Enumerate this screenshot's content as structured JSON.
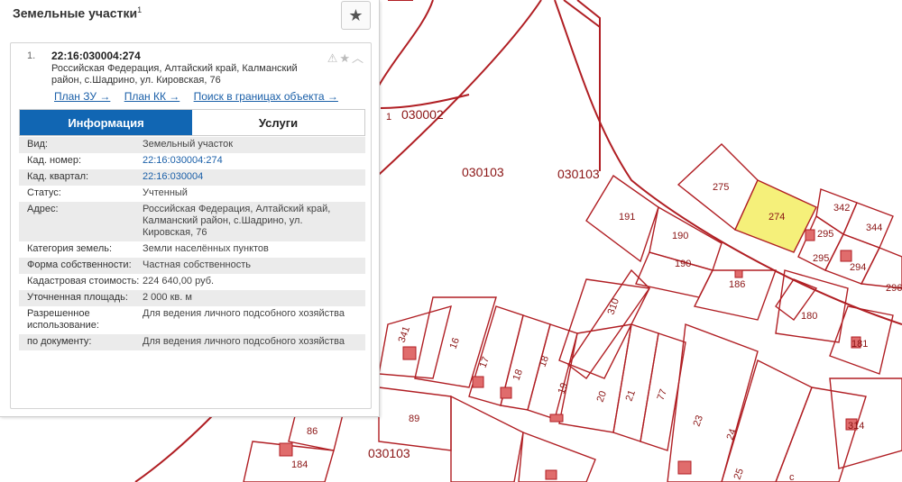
{
  "panel": {
    "title": "Земельные участки",
    "title_sup": "1",
    "star_icon": "★"
  },
  "record": {
    "number": "1.",
    "cad_number": "22:16:030004:274",
    "address": "Российская Федерация, Алтайский край, Калманский район, с.Шадрино, ул. Кировская, 76",
    "icons": "⚠★︿",
    "links": [
      "План ЗУ →",
      "План КК →",
      "Поиск в границах объекта →"
    ]
  },
  "tabs": [
    "Информация",
    "Услуги"
  ],
  "info": [
    {
      "k": "Вид:",
      "v": "Земельный участок"
    },
    {
      "k": "Кад. номер:",
      "v": "22:16:030004:274"
    },
    {
      "k": "Кад. квартал:",
      "v": "22:16:030004"
    },
    {
      "k": "Статус:",
      "v": "Учтенный"
    },
    {
      "k": "Адрес:",
      "v": "Российская Федерация, Алтайский край, Калманский район, с.Шадрино, ул. Кировская, 76"
    },
    {
      "k": "Категория земель:",
      "v": "Земли населённых пунктов"
    },
    {
      "k": "Форма собственности:",
      "v": "Частная собственность"
    },
    {
      "k": "Кадастровая стоимость:",
      "v": "224 640,00 руб."
    },
    {
      "k": "Уточненная площадь:",
      "v": "2 000 кв. м"
    },
    {
      "k": "Разрешенное использование:",
      "v": "Для ведения личного подсобного хозяйства"
    },
    {
      "k": "по документу:",
      "v": "Для ведения личного подсобного хозяйства"
    }
  ],
  "map": {
    "quarter_labels": [
      "030002",
      "030103",
      "030103",
      "030103"
    ],
    "parcel_labels": [
      "1",
      "275",
      "274",
      "342",
      "344",
      "295",
      "295",
      "294",
      "296",
      "191",
      "190",
      "190",
      "186",
      "180",
      "181",
      "310",
      "341",
      "16",
      "17",
      "18",
      "18",
      "19",
      "20",
      "21",
      "77",
      "23",
      "24",
      "25",
      "314",
      "89",
      "86",
      "184",
      "с"
    ],
    "selected_fill": "#f5f07a",
    "line_color": "#b01e23"
  }
}
